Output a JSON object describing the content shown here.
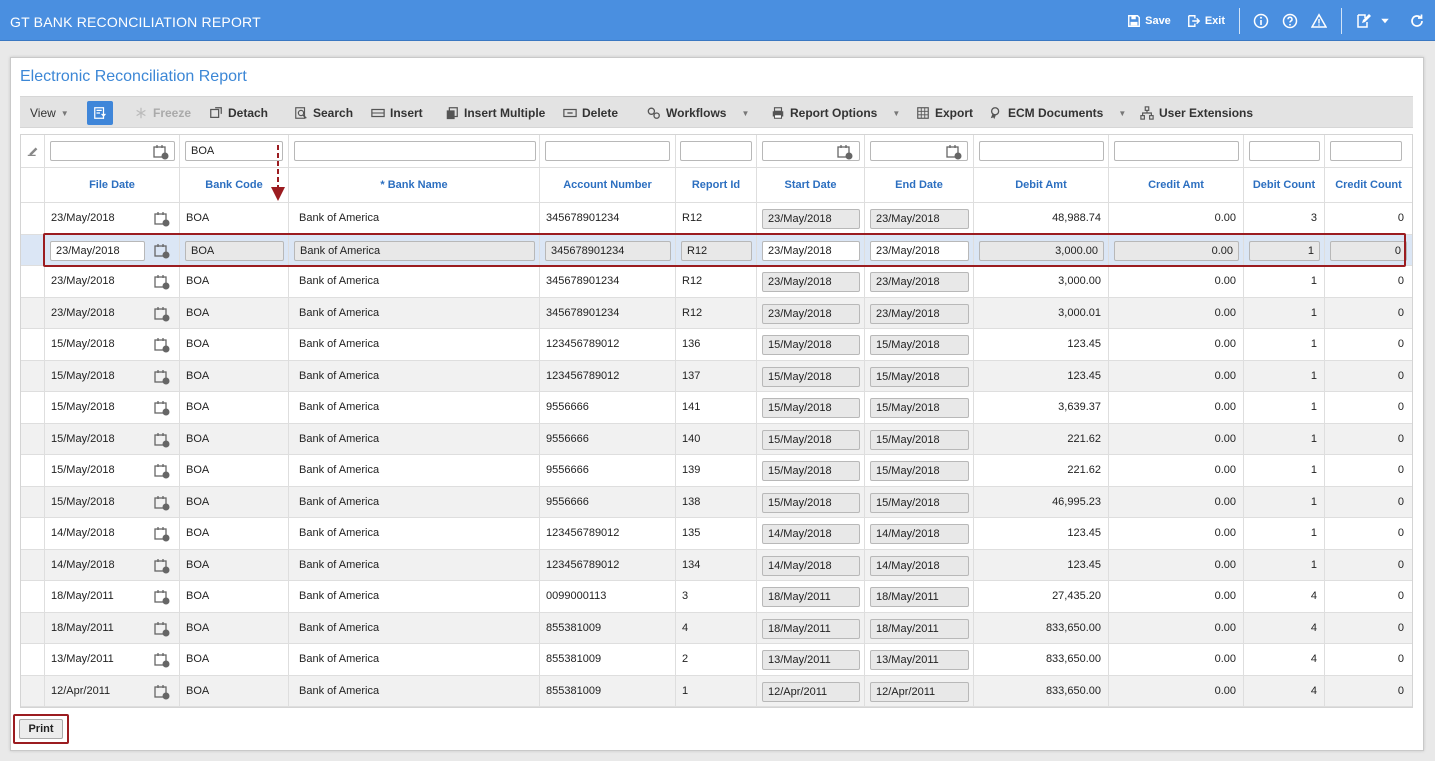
{
  "window": {
    "title": "GT BANK RECONCILIATION REPORT",
    "save_label": "Save",
    "exit_label": "Exit"
  },
  "page": {
    "title": "Electronic Reconciliation Report"
  },
  "toolbar": {
    "view": "View",
    "freeze": "Freeze",
    "detach": "Detach",
    "search": "Search",
    "insert": "Insert",
    "insert_multiple": "Insert Multiple",
    "delete": "Delete",
    "workflows": "Workflows",
    "report_options": "Report Options",
    "export": "Export",
    "ecm_documents": "ECM Documents",
    "user_extensions": "User Extensions"
  },
  "filters": {
    "bank_code": "BOA"
  },
  "columns": {
    "file_date": "File Date",
    "bank_code": "Bank Code",
    "bank_name": "* Bank Name",
    "account_number": "Account Number",
    "report_id": "Report Id",
    "start_date": "Start Date",
    "end_date": "End Date",
    "debit_amt": "Debit Amt",
    "credit_amt": "Credit Amt",
    "debit_count": "Debit Count",
    "credit_count": "Credit Count"
  },
  "rows": [
    {
      "file_date": "23/May/2018",
      "bank_code": "BOA",
      "bank_name": "Bank of America",
      "account_number": "345678901234",
      "report_id": "R12",
      "start_date": "23/May/2018",
      "end_date": "23/May/2018",
      "debit_amt": "48,988.74",
      "credit_amt": "0.00",
      "debit_count": "3",
      "credit_count": "0"
    },
    {
      "file_date": "23/May/2018",
      "bank_code": "BOA",
      "bank_name": "Bank of America",
      "account_number": "345678901234",
      "report_id": "R12",
      "start_date": "23/May/2018",
      "end_date": "23/May/2018",
      "debit_amt": "3,000.00",
      "credit_amt": "0.00",
      "debit_count": "1",
      "credit_count": "0"
    },
    {
      "file_date": "23/May/2018",
      "bank_code": "BOA",
      "bank_name": "Bank of America",
      "account_number": "345678901234",
      "report_id": "R12",
      "start_date": "23/May/2018",
      "end_date": "23/May/2018",
      "debit_amt": "3,000.00",
      "credit_amt": "0.00",
      "debit_count": "1",
      "credit_count": "0"
    },
    {
      "file_date": "23/May/2018",
      "bank_code": "BOA",
      "bank_name": "Bank of America",
      "account_number": "345678901234",
      "report_id": "R12",
      "start_date": "23/May/2018",
      "end_date": "23/May/2018",
      "debit_amt": "3,000.01",
      "credit_amt": "0.00",
      "debit_count": "1",
      "credit_count": "0"
    },
    {
      "file_date": "15/May/2018",
      "bank_code": "BOA",
      "bank_name": "Bank of America",
      "account_number": "123456789012",
      "report_id": "136",
      "start_date": "15/May/2018",
      "end_date": "15/May/2018",
      "debit_amt": "123.45",
      "credit_amt": "0.00",
      "debit_count": "1",
      "credit_count": "0"
    },
    {
      "file_date": "15/May/2018",
      "bank_code": "BOA",
      "bank_name": "Bank of America",
      "account_number": "123456789012",
      "report_id": "137",
      "start_date": "15/May/2018",
      "end_date": "15/May/2018",
      "debit_amt": "123.45",
      "credit_amt": "0.00",
      "debit_count": "1",
      "credit_count": "0"
    },
    {
      "file_date": "15/May/2018",
      "bank_code": "BOA",
      "bank_name": "Bank of America",
      "account_number": "9556666",
      "report_id": "141",
      "start_date": "15/May/2018",
      "end_date": "15/May/2018",
      "debit_amt": "3,639.37",
      "credit_amt": "0.00",
      "debit_count": "1",
      "credit_count": "0"
    },
    {
      "file_date": "15/May/2018",
      "bank_code": "BOA",
      "bank_name": "Bank of America",
      "account_number": "9556666",
      "report_id": "140",
      "start_date": "15/May/2018",
      "end_date": "15/May/2018",
      "debit_amt": "221.62",
      "credit_amt": "0.00",
      "debit_count": "1",
      "credit_count": "0"
    },
    {
      "file_date": "15/May/2018",
      "bank_code": "BOA",
      "bank_name": "Bank of America",
      "account_number": "9556666",
      "report_id": "139",
      "start_date": "15/May/2018",
      "end_date": "15/May/2018",
      "debit_amt": "221.62",
      "credit_amt": "0.00",
      "debit_count": "1",
      "credit_count": "0"
    },
    {
      "file_date": "15/May/2018",
      "bank_code": "BOA",
      "bank_name": "Bank of America",
      "account_number": "9556666",
      "report_id": "138",
      "start_date": "15/May/2018",
      "end_date": "15/May/2018",
      "debit_amt": "46,995.23",
      "credit_amt": "0.00",
      "debit_count": "1",
      "credit_count": "0"
    },
    {
      "file_date": "14/May/2018",
      "bank_code": "BOA",
      "bank_name": "Bank of America",
      "account_number": "123456789012",
      "report_id": "135",
      "start_date": "14/May/2018",
      "end_date": "14/May/2018",
      "debit_amt": "123.45",
      "credit_amt": "0.00",
      "debit_count": "1",
      "credit_count": "0"
    },
    {
      "file_date": "14/May/2018",
      "bank_code": "BOA",
      "bank_name": "Bank of America",
      "account_number": "123456789012",
      "report_id": "134",
      "start_date": "14/May/2018",
      "end_date": "14/May/2018",
      "debit_amt": "123.45",
      "credit_amt": "0.00",
      "debit_count": "1",
      "credit_count": "0"
    },
    {
      "file_date": "18/May/2011",
      "bank_code": "BOA",
      "bank_name": "Bank of America",
      "account_number": "0099000113",
      "report_id": "3",
      "start_date": "18/May/2011",
      "end_date": "18/May/2011",
      "debit_amt": "27,435.20",
      "credit_amt": "0.00",
      "debit_count": "4",
      "credit_count": "0"
    },
    {
      "file_date": "18/May/2011",
      "bank_code": "BOA",
      "bank_name": "Bank of America",
      "account_number": "855381009",
      "report_id": "4",
      "start_date": "18/May/2011",
      "end_date": "18/May/2011",
      "debit_amt": "833,650.00",
      "credit_amt": "0.00",
      "debit_count": "4",
      "credit_count": "0"
    },
    {
      "file_date": "13/May/2011",
      "bank_code": "BOA",
      "bank_name": "Bank of America",
      "account_number": "855381009",
      "report_id": "2",
      "start_date": "13/May/2011",
      "end_date": "13/May/2011",
      "debit_amt": "833,650.00",
      "credit_amt": "0.00",
      "debit_count": "4",
      "credit_count": "0"
    },
    {
      "file_date": "12/Apr/2011",
      "bank_code": "BOA",
      "bank_name": "Bank of America",
      "account_number": "855381009",
      "report_id": "1",
      "start_date": "12/Apr/2011",
      "end_date": "12/Apr/2011",
      "debit_amt": "833,650.00",
      "credit_amt": "0.00",
      "debit_count": "4",
      "credit_count": "0"
    }
  ],
  "selected_row": 1,
  "print_label": "Print",
  "colors": {
    "title_bar": "#4a8fe0",
    "header_text": "#2c6fc0",
    "highlight": "#9b1c20",
    "selected_row": "#dbe6f5"
  }
}
